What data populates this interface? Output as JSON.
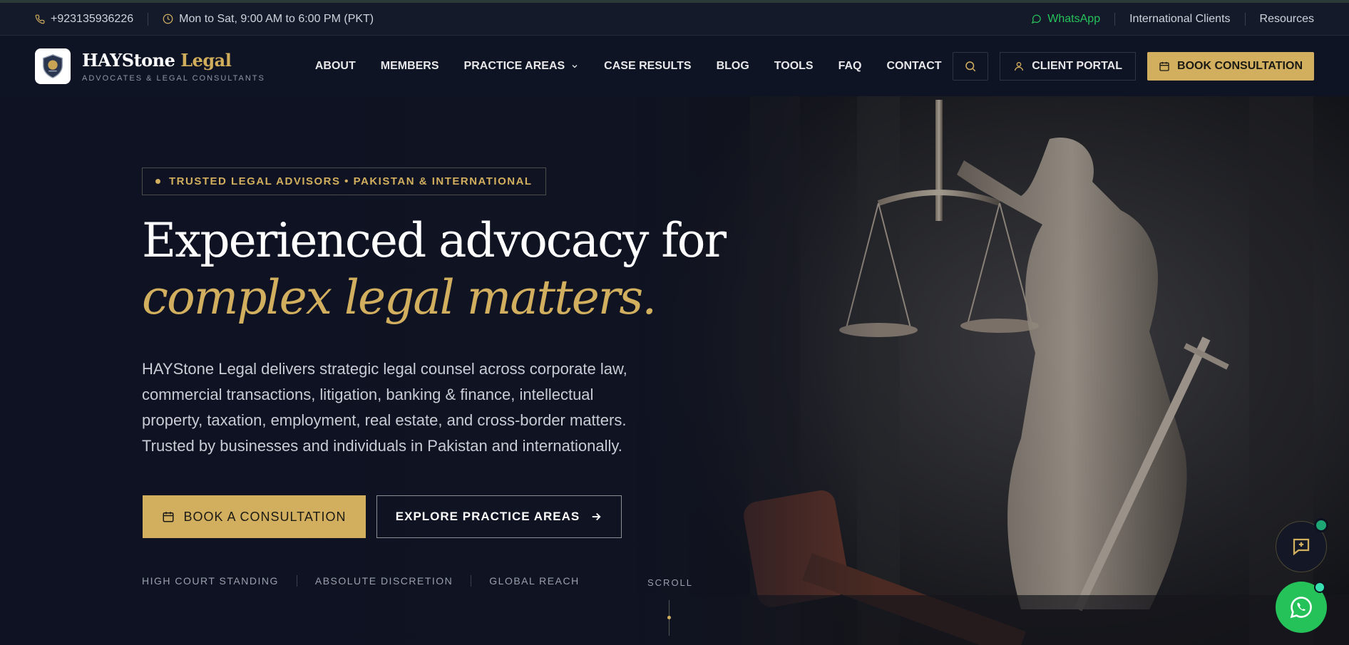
{
  "topbar": {
    "phone": "+923135936226",
    "hours": "Mon to Sat, 9:00 AM to 6:00 PM (PKT)",
    "whatsapp": "WhatsApp",
    "international": "International Clients",
    "resources": "Resources"
  },
  "brand": {
    "name_main": "HAYStone",
    "name_accent": "Legal",
    "tagline": "ADVOCATES & LEGAL CONSULTANTS"
  },
  "nav": {
    "items": [
      "ABOUT",
      "MEMBERS",
      "PRACTICE AREAS",
      "CASE RESULTS",
      "BLOG",
      "TOOLS",
      "FAQ",
      "CONTACT"
    ],
    "client_portal": "CLIENT PORTAL",
    "book": "BOOK CONSULTATION"
  },
  "hero": {
    "badge": "TRUSTED LEGAL ADVISORS • PAKISTAN & INTERNATIONAL",
    "title_line1": "Experienced advocacy for",
    "title_line2": "complex legal matters.",
    "lead": "HAYStone Legal delivers strategic legal counsel across corporate law, commercial transactions, litigation, banking & finance, intellectual property, taxation, employment, real estate, and cross-border matters. Trusted by businesses and individuals in Pakistan and internationally.",
    "cta_primary": "BOOK A CONSULTATION",
    "cta_secondary": "EXPLORE PRACTICE AREAS",
    "features": [
      "HIGH COURT STANDING",
      "ABSOLUTE DISCRETION",
      "GLOBAL REACH"
    ],
    "scroll": "SCROLL"
  },
  "colors": {
    "gold": "#d2af5f",
    "navy": "#0e1220",
    "whatsapp": "#25c25a"
  }
}
